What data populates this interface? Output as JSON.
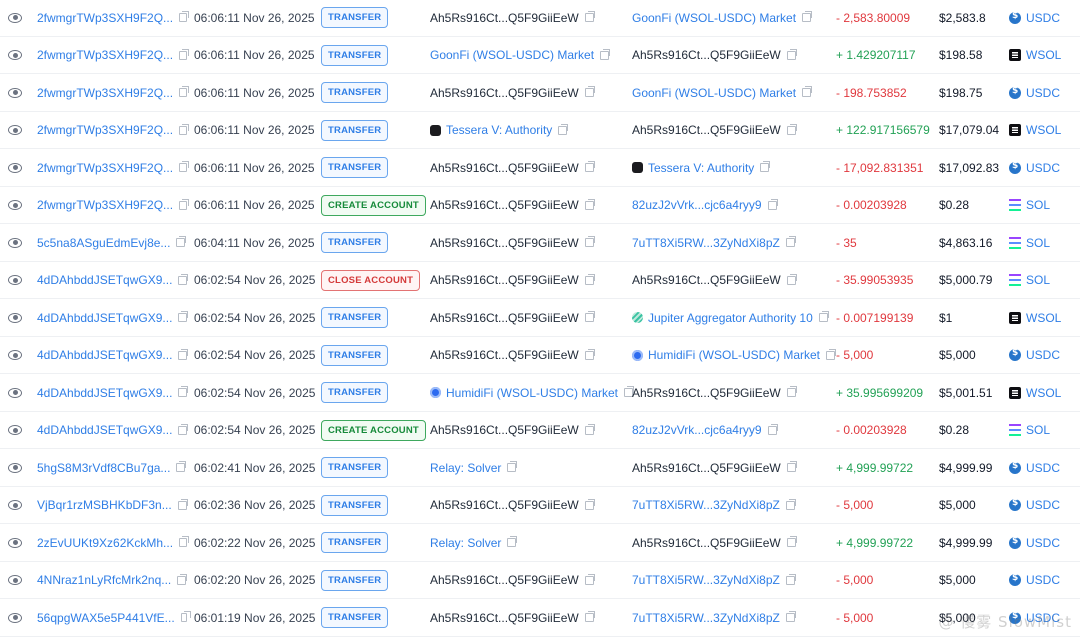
{
  "rows": [
    {
      "sig": "2fwmgrTWp3SXH9F2Q...",
      "time": "06:06:11 Nov 26, 2025",
      "type": "TRANSFER",
      "type_kind": "transfer",
      "from": "Ah5Rs916Ct...Q5F9GiiEeW",
      "from_kind": "plain",
      "from_icon": "",
      "to": "GoonFi (WSOL-USDC) Market",
      "to_kind": "link",
      "to_icon": "",
      "amount": "- 2,583.80009",
      "amount_sign": "neg",
      "value": "$2,583.8",
      "token": "USDC",
      "token_icon": "usdc"
    },
    {
      "sig": "2fwmgrTWp3SXH9F2Q...",
      "time": "06:06:11 Nov 26, 2025",
      "type": "TRANSFER",
      "type_kind": "transfer",
      "from": "GoonFi (WSOL-USDC) Market",
      "from_kind": "link",
      "from_icon": "",
      "to": "Ah5Rs916Ct...Q5F9GiiEeW",
      "to_kind": "plain",
      "to_icon": "",
      "amount": "+ 1.429207117",
      "amount_sign": "pos",
      "value": "$198.58",
      "token": "WSOL",
      "token_icon": "wsol"
    },
    {
      "sig": "2fwmgrTWp3SXH9F2Q...",
      "time": "06:06:11 Nov 26, 2025",
      "type": "TRANSFER",
      "type_kind": "transfer",
      "from": "Ah5Rs916Ct...Q5F9GiiEeW",
      "from_kind": "plain",
      "from_icon": "",
      "to": "GoonFi (WSOL-USDC) Market",
      "to_kind": "link",
      "to_icon": "",
      "amount": "- 198.753852",
      "amount_sign": "neg",
      "value": "$198.75",
      "token": "USDC",
      "token_icon": "usdc"
    },
    {
      "sig": "2fwmgrTWp3SXH9F2Q...",
      "time": "06:06:11 Nov 26, 2025",
      "type": "TRANSFER",
      "type_kind": "transfer",
      "from": "Tessera V: Authority",
      "from_kind": "link",
      "from_icon": "dark",
      "to": "Ah5Rs916Ct...Q5F9GiiEeW",
      "to_kind": "plain",
      "to_icon": "",
      "amount": "+ 122.917156579",
      "amount_sign": "pos",
      "value": "$17,079.04",
      "token": "WSOL",
      "token_icon": "wsol"
    },
    {
      "sig": "2fwmgrTWp3SXH9F2Q...",
      "time": "06:06:11 Nov 26, 2025",
      "type": "TRANSFER",
      "type_kind": "transfer",
      "from": "Ah5Rs916Ct...Q5F9GiiEeW",
      "from_kind": "plain",
      "from_icon": "",
      "to": "Tessera V: Authority",
      "to_kind": "link",
      "to_icon": "dark",
      "amount": "- 17,092.831351",
      "amount_sign": "neg",
      "value": "$17,092.83",
      "token": "USDC",
      "token_icon": "usdc"
    },
    {
      "sig": "2fwmgrTWp3SXH9F2Q...",
      "time": "06:06:11 Nov 26, 2025",
      "type": "CREATE ACCOUNT",
      "type_kind": "create",
      "from": "Ah5Rs916Ct...Q5F9GiiEeW",
      "from_kind": "plain",
      "from_icon": "",
      "to": "82uzJ2vVrk...cjc6a4ryy9",
      "to_kind": "link",
      "to_icon": "",
      "amount": "- 0.00203928",
      "amount_sign": "neg",
      "value": "$0.28",
      "token": "SOL",
      "token_icon": "sol"
    },
    {
      "sig": "5c5na8ASguEdmEvj8e...",
      "time": "06:04:11 Nov 26, 2025",
      "type": "TRANSFER",
      "type_kind": "transfer",
      "from": "Ah5Rs916Ct...Q5F9GiiEeW",
      "from_kind": "plain",
      "from_icon": "",
      "to": "7uTT8Xi5RW...3ZyNdXi8pZ",
      "to_kind": "link",
      "to_icon": "",
      "amount": "- 35",
      "amount_sign": "neg",
      "value": "$4,863.16",
      "token": "SOL",
      "token_icon": "sol"
    },
    {
      "sig": "4dDAhbddJSETqwGX9...",
      "time": "06:02:54 Nov 26, 2025",
      "type": "CLOSE ACCOUNT",
      "type_kind": "close",
      "from": "Ah5Rs916Ct...Q5F9GiiEeW",
      "from_kind": "plain",
      "from_icon": "",
      "to": "Ah5Rs916Ct...Q5F9GiiEeW",
      "to_kind": "plain",
      "to_icon": "",
      "amount": "- 35.99053935",
      "amount_sign": "neg",
      "value": "$5,000.79",
      "token": "SOL",
      "token_icon": "sol"
    },
    {
      "sig": "4dDAhbddJSETqwGX9...",
      "time": "06:02:54 Nov 26, 2025",
      "type": "TRANSFER",
      "type_kind": "transfer",
      "from": "Ah5Rs916Ct...Q5F9GiiEeW",
      "from_kind": "plain",
      "from_icon": "",
      "to": "Jupiter Aggregator Authority 10",
      "to_kind": "link",
      "to_icon": "jup",
      "amount": "- 0.007199139",
      "amount_sign": "neg",
      "value": "$1",
      "token": "WSOL",
      "token_icon": "wsol"
    },
    {
      "sig": "4dDAhbddJSETqwGX9...",
      "time": "06:02:54 Nov 26, 2025",
      "type": "TRANSFER",
      "type_kind": "transfer",
      "from": "Ah5Rs916Ct...Q5F9GiiEeW",
      "from_kind": "plain",
      "from_icon": "",
      "to": "HumidiFi (WSOL-USDC) Market",
      "to_kind": "link",
      "to_icon": "blue",
      "amount": "- 5,000",
      "amount_sign": "neg",
      "value": "$5,000",
      "token": "USDC",
      "token_icon": "usdc"
    },
    {
      "sig": "4dDAhbddJSETqwGX9...",
      "time": "06:02:54 Nov 26, 2025",
      "type": "TRANSFER",
      "type_kind": "transfer",
      "from": "HumidiFi (WSOL-USDC) Market",
      "from_kind": "link",
      "from_icon": "blue",
      "to": "Ah5Rs916Ct...Q5F9GiiEeW",
      "to_kind": "plain",
      "to_icon": "",
      "amount": "+ 35.995699209",
      "amount_sign": "pos",
      "value": "$5,001.51",
      "token": "WSOL",
      "token_icon": "wsol"
    },
    {
      "sig": "4dDAhbddJSETqwGX9...",
      "time": "06:02:54 Nov 26, 2025",
      "type": "CREATE ACCOUNT",
      "type_kind": "create",
      "from": "Ah5Rs916Ct...Q5F9GiiEeW",
      "from_kind": "plain",
      "from_icon": "",
      "to": "82uzJ2vVrk...cjc6a4ryy9",
      "to_kind": "link",
      "to_icon": "",
      "amount": "- 0.00203928",
      "amount_sign": "neg",
      "value": "$0.28",
      "token": "SOL",
      "token_icon": "sol"
    },
    {
      "sig": "5hgS8M3rVdf8CBu7ga...",
      "time": "06:02:41 Nov 26, 2025",
      "type": "TRANSFER",
      "type_kind": "transfer",
      "from": "Relay: Solver",
      "from_kind": "link",
      "from_icon": "",
      "to": "Ah5Rs916Ct...Q5F9GiiEeW",
      "to_kind": "plain",
      "to_icon": "",
      "amount": "+ 4,999.99722",
      "amount_sign": "pos",
      "value": "$4,999.99",
      "token": "USDC",
      "token_icon": "usdc"
    },
    {
      "sig": "VjBqr1rzMSBHKbDF3n...",
      "time": "06:02:36 Nov 26, 2025",
      "type": "TRANSFER",
      "type_kind": "transfer",
      "from": "Ah5Rs916Ct...Q5F9GiiEeW",
      "from_kind": "plain",
      "from_icon": "",
      "to": "7uTT8Xi5RW...3ZyNdXi8pZ",
      "to_kind": "link",
      "to_icon": "",
      "amount": "- 5,000",
      "amount_sign": "neg",
      "value": "$5,000",
      "token": "USDC",
      "token_icon": "usdc"
    },
    {
      "sig": "2zEvUUKt9Xz62KckMh...",
      "time": "06:02:22 Nov 26, 2025",
      "type": "TRANSFER",
      "type_kind": "transfer",
      "from": "Relay: Solver",
      "from_kind": "link",
      "from_icon": "",
      "to": "Ah5Rs916Ct...Q5F9GiiEeW",
      "to_kind": "plain",
      "to_icon": "",
      "amount": "+ 4,999.99722",
      "amount_sign": "pos",
      "value": "$4,999.99",
      "token": "USDC",
      "token_icon": "usdc"
    },
    {
      "sig": "4NNraz1nLyRfcMrk2nq...",
      "time": "06:02:20 Nov 26, 2025",
      "type": "TRANSFER",
      "type_kind": "transfer",
      "from": "Ah5Rs916Ct...Q5F9GiiEeW",
      "from_kind": "plain",
      "from_icon": "",
      "to": "7uTT8Xi5RW...3ZyNdXi8pZ",
      "to_kind": "link",
      "to_icon": "",
      "amount": "- 5,000",
      "amount_sign": "neg",
      "value": "$5,000",
      "token": "USDC",
      "token_icon": "usdc"
    },
    {
      "sig": "56qpgWAX5e5P441VfE...",
      "time": "06:01:19 Nov 26, 2025",
      "type": "TRANSFER",
      "type_kind": "transfer",
      "from": "Ah5Rs916Ct...Q5F9GiiEeW",
      "from_kind": "plain",
      "from_icon": "",
      "to": "7uTT8Xi5RW...3ZyNdXi8pZ",
      "to_kind": "link",
      "to_icon": "",
      "amount": "- 5,000",
      "amount_sign": "neg",
      "value": "$5,000",
      "token": "USDC",
      "token_icon": "usdc"
    }
  ],
  "watermark": "@ 慢雾 SlowMist",
  "colors": {
    "link": "#2f7ee6",
    "negative": "#e0383e",
    "positive": "#22a155"
  }
}
